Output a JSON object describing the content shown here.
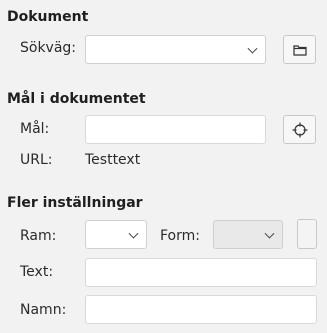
{
  "document_section": {
    "title": "Dokument",
    "path_label": "Sökväg:",
    "path_value": ""
  },
  "target_section": {
    "title": "Mål i dokumentet",
    "target_label": "Mål:",
    "target_value": "",
    "url_label": "URL:",
    "url_value": "Testtext"
  },
  "more_settings": {
    "title": "Fler inställningar",
    "frame_label": "Ram:",
    "frame_value": "",
    "form_label": "Form:",
    "form_value": "",
    "text_label": "Text:",
    "text_value": "",
    "name_label": "Namn:",
    "name_value": ""
  },
  "icons": {
    "open_file": "folder-icon",
    "target_button": "target-crosshair-icon",
    "dropdown": "chevron-down-icon"
  }
}
